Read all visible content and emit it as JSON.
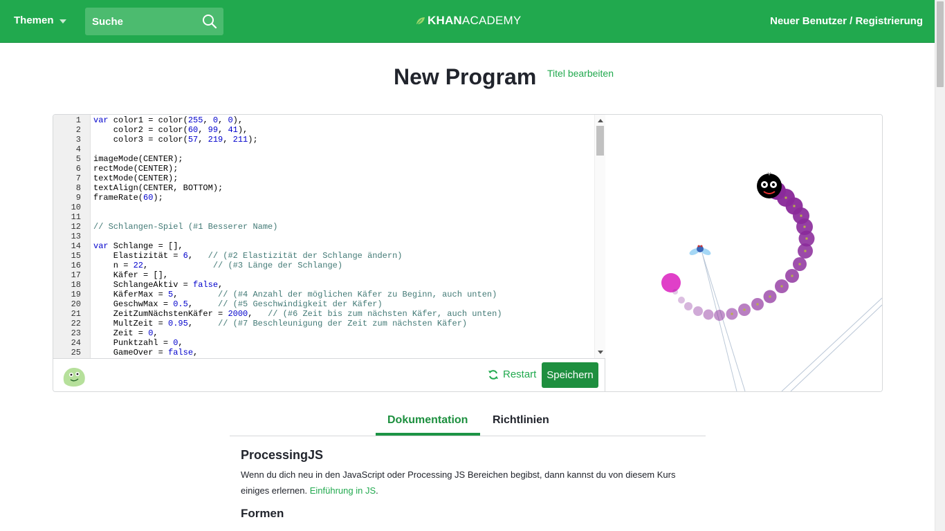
{
  "header": {
    "topics_label": "Themen",
    "search_placeholder": "Suche",
    "logo_bold": "KHAN",
    "logo_light": "ACADEMY",
    "signup_label": "Neuer Benutzer / Registrierung"
  },
  "program": {
    "title": "New Program",
    "edit_title_label": "Titel bearbeiten"
  },
  "editor": {
    "line_numbers": [
      "1",
      "2",
      "3",
      "4",
      "5",
      "6",
      "7",
      "8",
      "9",
      "10",
      "11",
      "12",
      "13",
      "14",
      "15",
      "16",
      "17",
      "18",
      "19",
      "20",
      "21",
      "22",
      "23",
      "24",
      "25"
    ],
    "lines": [
      "var color1 = color(255, 0, 0),",
      "    color2 = color(60, 99, 41),",
      "    color3 = color(57, 219, 211);",
      "",
      "imageMode(CENTER);",
      "rectMode(CENTER);",
      "textMode(CENTER);",
      "textAlign(CENTER, BOTTOM);",
      "frameRate(60);",
      "",
      "",
      "// Schlangen-Spiel (#1 Besserer Name)",
      "",
      "var Schlange = [],",
      "    Elastizität = 6,   // (#2 Elastizität der Schlange ändern)",
      "    n = 22,             // (#3 Länge der Schlange)",
      "    Käfer = [],",
      "    SchlangeAktiv = false,",
      "    KäferMax = 5,        // (#4 Anzahl der möglichen Käfer zu Beginn, auch unten)",
      "    GeschwMax = 0.5,     // (#5 Geschwindigkeit der Käfer)",
      "    ZeitZumNächstenKäfer = 2000,   // (#6 Zeit bis zum nächsten Käfer, auch unten)",
      "    MultZeit = 0.95,     // (#7 Beschleunigung der Zeit zum nächsten Käfer)",
      "    Zeit = 0,",
      "    Punktzahl = 0,",
      "    GameOver = false,"
    ],
    "restart_label": "Restart",
    "save_label": "Speichern"
  },
  "tabs": {
    "documentation": "Dokumentation",
    "guidelines": "Richtlinien"
  },
  "doc": {
    "heading": "ProcessingJS",
    "intro_text": "Wenn du dich neu in den JavaScript oder Processing JS Bereichen begibst, dann kannst du von diesem Kurs einiges erlernen. ",
    "intro_link": "Einführung in JS",
    "intro_end": ".",
    "subheading": "Formen"
  },
  "colors": {
    "header_green": "#21a94e",
    "save_green": "#1e8f3f",
    "snake_purple": "#8a2a9a",
    "food_pink": "#e040c8"
  }
}
